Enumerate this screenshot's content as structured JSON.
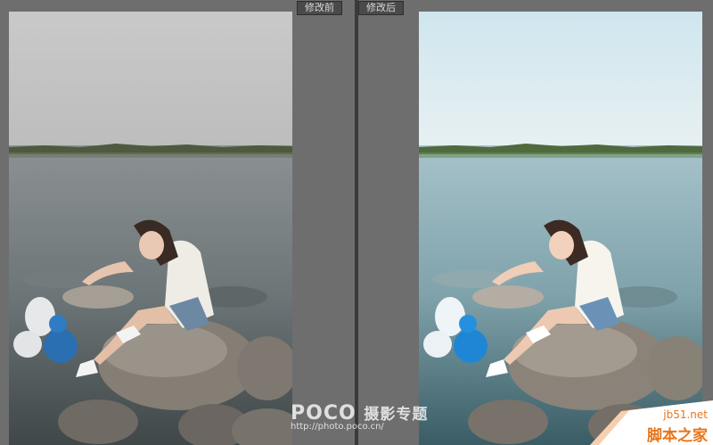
{
  "panes": {
    "before": {
      "label": "修改前"
    },
    "after": {
      "label": "修改后"
    }
  },
  "watermark": {
    "logo": "POCO",
    "title": "摄影专题",
    "url": "http://photo.poco.cn/"
  },
  "corner_badge": {
    "site": "jb51.net",
    "name": "脚本之家"
  },
  "colors": {
    "panel": "#6e6e6e",
    "divider": "#3a3a3a",
    "tab_bg": "#4a4a4a",
    "accent": "#e8751a"
  }
}
